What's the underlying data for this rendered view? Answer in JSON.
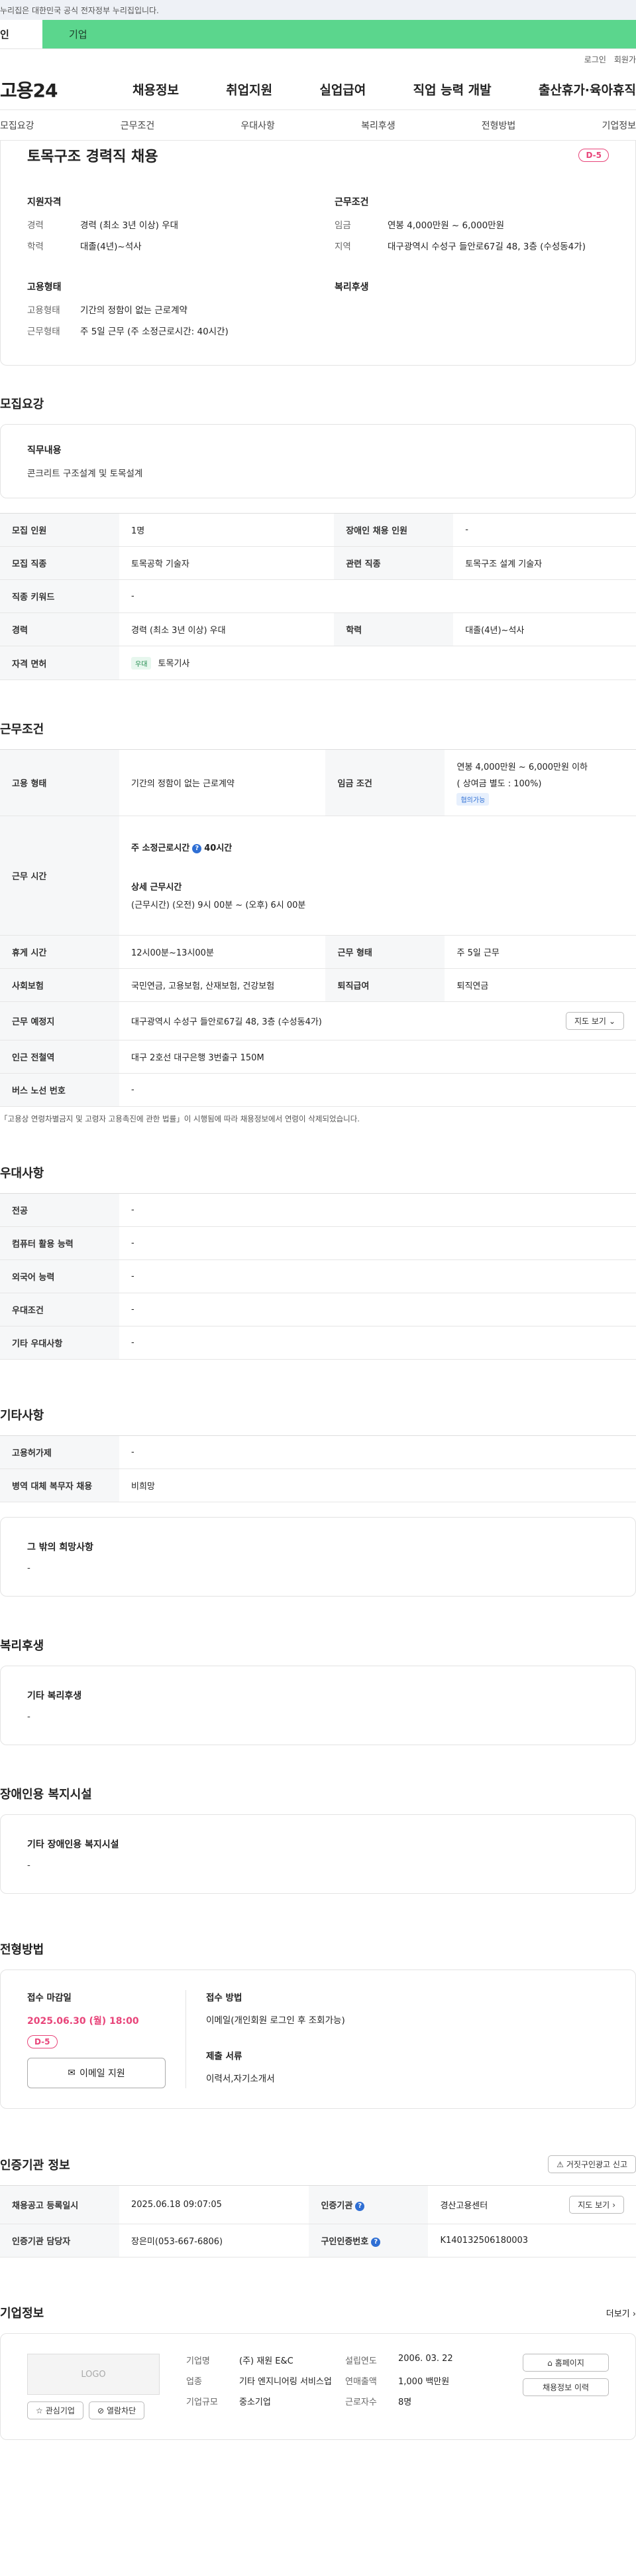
{
  "topbar": {
    "notice": "누리집은 대한민국 공식 전자정부 누리집입니다."
  },
  "tabs": {
    "personal": "인",
    "company": "기업"
  },
  "auth": {
    "login": "로그인",
    "signup": "회원가"
  },
  "gnb": {
    "logo": "고용24",
    "items": [
      "채용정보",
      "취업지원",
      "실업급여",
      "직업 능력 개발",
      "출산휴가·육아휴직"
    ]
  },
  "subnav": {
    "items": [
      "모집요강",
      "근무조건",
      "우대사항",
      "복리후생",
      "전형방법",
      "기업정보"
    ]
  },
  "job": {
    "title": "토목구조 경력직 채용",
    "dday": "D-5",
    "support": {
      "title": "지원자격",
      "rows": [
        {
          "k": "경력",
          "v": "경력 (최소 3년 이상) 우대"
        },
        {
          "k": "학력",
          "v": "대졸(4년)~석사"
        }
      ]
    },
    "work": {
      "title": "근무조건",
      "rows": [
        {
          "k": "임금",
          "v": "연봉 4,000만원 ~ 6,000만원"
        },
        {
          "k": "지역",
          "v": "대구광역시 수성구 들안로67길 48, 3층 (수성동4가)"
        }
      ]
    },
    "employ": {
      "title": "고용형태",
      "rows": [
        {
          "k": "고용형태",
          "v": "기간의 정함이 없는 근로계약"
        },
        {
          "k": "근무형태",
          "v": "주 5일 근무 (주 소정근로시간: 40시간)"
        }
      ]
    },
    "welfare": {
      "title": "복리후생"
    }
  },
  "recruit": {
    "title": "모집요강",
    "duty_label": "직무내용",
    "duty_value": "콘크리트 구조설계 및 토목설계",
    "rows": [
      {
        "k1": "모집 인원",
        "v1": "1명",
        "k2": "장애인 채용 인원",
        "v2": "-"
      },
      {
        "k1": "모집 직종",
        "v1": "토목공학 기술자",
        "k2": "관련 직종",
        "v2": "토목구조 설계 기술자"
      },
      {
        "k1": "직종 키워드",
        "v1": "-"
      },
      {
        "k1": "경력",
        "v1": "경력 (최소 3년 이상) 우대",
        "k2": "학력",
        "v2": "대졸(4년)~석사"
      }
    ],
    "license_label": "자격 면허",
    "license_tag": "우대",
    "license_value": "토목기사"
  },
  "conditions": {
    "title": "근무조건",
    "employ_type_k": "고용 형태",
    "employ_type_v": "기간의 정함이 없는 근로계약",
    "wage_k": "임금 조건",
    "wage_v1": "연봉 4,000만원 ~ 6,000만원 이하",
    "wage_v2": "( 상여금 별도 : 100%)",
    "wage_tag": "협의가능",
    "hours_k": "근무 시간",
    "hours_main": "주 소정근로시간",
    "hours_main_v": "40시간",
    "hours_detail_label": "상세 근무시간",
    "hours_detail_v": "(근무시간) (오전) 9시 00분 ~ (오후) 6시 00분",
    "break_k": "휴게 시간",
    "break_v": "12시00분~13시00분",
    "workform_k": "근무 형태",
    "workform_v": "주 5일 근무",
    "insurance_k": "사회보험",
    "insurance_v": "국민연금, 고용보험, 산재보험, 건강보험",
    "retire_k": "퇴직급여",
    "retire_v": "퇴직연금",
    "place_k": "근무 예정지",
    "place_v": "대구광역시 수성구 들안로67길 48, 3층 (수성동4가)",
    "map_btn": "지도 보기",
    "subway_k": "인근 전철역",
    "subway_v": "대구 2호선 대구은행 3번출구 150M",
    "bus_k": "버스 노선 번호",
    "bus_v": "-",
    "footnote": "「고용상 연령차별금지 및 고령자 고용촉진에 관한 법률」이 시행됨에 따라 채용정보에서 연령이 삭제되었습니다."
  },
  "preference": {
    "title": "우대사항",
    "rows": [
      {
        "k": "전공",
        "v": "-"
      },
      {
        "k": "컴퓨터 활용 능력",
        "v": "-"
      },
      {
        "k": "외국어 능력",
        "v": "-"
      },
      {
        "k": "우대조건",
        "v": "-"
      },
      {
        "k": "기타 우대사항",
        "v": "-"
      }
    ]
  },
  "etc": {
    "title": "기타사항",
    "rows": [
      {
        "k": "고용허가제",
        "v": "-"
      },
      {
        "k": "병역 대체 복무자 채용",
        "v": "비희망"
      }
    ],
    "box_label": "그 밖의 희망사항",
    "box_value": "-"
  },
  "benefit": {
    "title": "복리후생",
    "label": "기타 복리후생",
    "value": "-"
  },
  "disabled": {
    "title": "장애인용 복지시설",
    "label": "기타 장애인용 복지시설",
    "value": "-"
  },
  "process": {
    "title": "전형방법",
    "deadline_label": "접수 마감일",
    "deadline_value": "2025.06.30 (월) 18:00",
    "dday": "D-5",
    "email_btn": "이메일 지원",
    "method_label": "접수 방법",
    "method_value": "이메일(개인회원 로그인 후 조회가능)",
    "docs_label": "제출 서류",
    "docs_value": "이력서,자기소개서"
  },
  "auth_org": {
    "title": "인증기관 정보",
    "report_btn": "거짓구인광고 신고",
    "r1k1": "채용공고 등록일시",
    "r1v1": "2025.06.18 09:07:05",
    "r1k2": "인증기관",
    "r1v2": "경산고용센터",
    "map_btn": "지도 보기",
    "r2k1": "인증기관 담당자",
    "r2v1": "장은미(053-667-6806)",
    "r2k2": "구인인증번호",
    "r2v2": "K140132506180003"
  },
  "company": {
    "title": "기업정보",
    "more": "더보기",
    "logo_text": "LOGO",
    "fav_btn": "관심기업",
    "block_btn": "열람차단",
    "name_k": "기업명",
    "name_v": "(주) 재원 E&C",
    "industry_k": "업종",
    "industry_v": "기타 엔지니어링 서비스업",
    "size_k": "기업규모",
    "size_v": "중소기업",
    "founded_k": "설립연도",
    "founded_v": "2006. 03. 22",
    "sales_k": "연매출액",
    "sales_v": "1,000 백만원",
    "staff_k": "근로자수",
    "staff_v": "8명",
    "home_btn": "홈페이지",
    "history_btn": "채용정보 이력"
  }
}
